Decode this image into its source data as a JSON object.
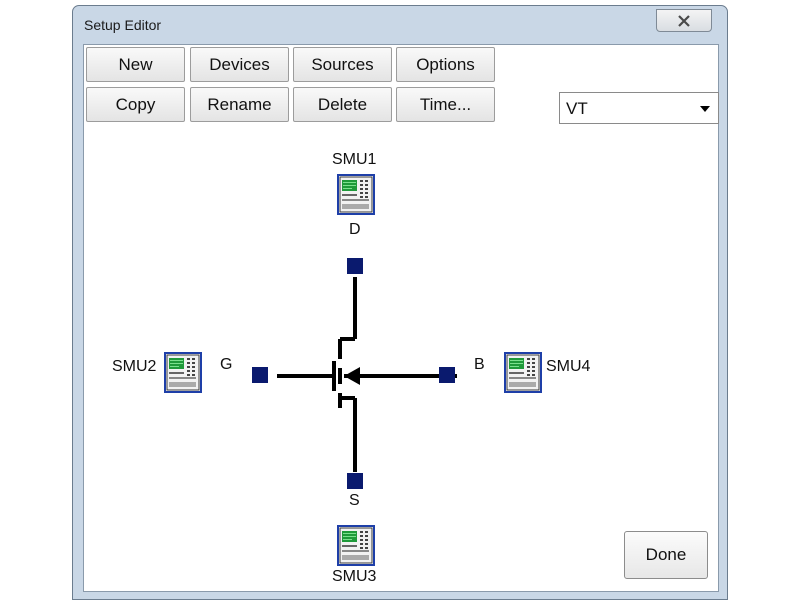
{
  "window": {
    "title": "Setup Editor"
  },
  "toolbar": {
    "row1": [
      "New",
      "Devices",
      "Sources",
      "Options"
    ],
    "row2": [
      "Copy",
      "Rename",
      "Delete",
      "Time..."
    ]
  },
  "selector": {
    "value": "VT"
  },
  "schematic": {
    "smus": {
      "top": "SMU1",
      "left": "SMU2",
      "bottom": "SMU3",
      "right": "SMU4"
    },
    "terminals": {
      "drain": "D",
      "gate": "G",
      "source": "S",
      "bulk": "B"
    }
  },
  "done_label": "Done",
  "icons": {
    "close": "close-icon",
    "dropdown": "chevron-down-icon",
    "smu": "smu-instrument-icon"
  },
  "colors": {
    "terminal": "#0a1a6e",
    "smu_border": "#1e3fa8",
    "screen": "#1f9a3a"
  }
}
